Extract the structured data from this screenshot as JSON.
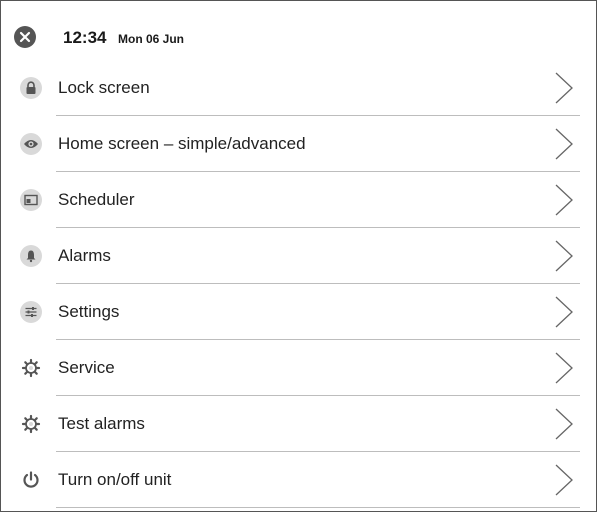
{
  "header": {
    "time": "12:34",
    "date": "Mon 06 Jun"
  },
  "menu": {
    "items": [
      {
        "label": "Lock screen",
        "icon": "lock-icon"
      },
      {
        "label": "Home screen – simple/advanced",
        "icon": "eye-icon"
      },
      {
        "label": "Scheduler",
        "icon": "calendar-icon"
      },
      {
        "label": "Alarms",
        "icon": "bell-icon"
      },
      {
        "label": "Settings",
        "icon": "sliders-icon"
      },
      {
        "label": "Service",
        "icon": "gear-icon"
      },
      {
        "label": "Test alarms",
        "icon": "gear-icon"
      },
      {
        "label": "Turn on/off unit",
        "icon": "power-icon"
      }
    ]
  },
  "colors": {
    "icon": "#555555",
    "icon_bg": "#d9d9d9",
    "divider": "#bdbdbd",
    "chevron": "#666666"
  }
}
